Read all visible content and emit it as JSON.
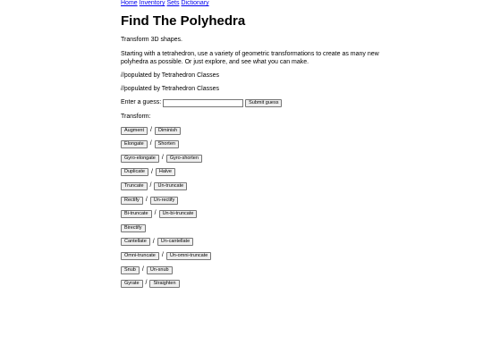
{
  "nav": {
    "links": [
      "Home",
      "Inventory",
      "Sets",
      "Dictionary"
    ]
  },
  "page_title": "Find The Polyhedra",
  "tagline": "Transform 3D shapes.",
  "description": "Starting with a tetrahedron, use a variety of geometric transformations to create as many new polyhedra as possible. Or just explore, and see what you can make.",
  "populated_1": "//populated by Tetrahedron Classes",
  "populated_2": "//populated by Tetrahedron Classes",
  "guess": {
    "label": "Enter a guess:",
    "value": "",
    "placeholder": "",
    "submit_label": "Submit guess"
  },
  "transform_label": "Transform:",
  "separator": "/",
  "transforms": [
    [
      "Augment",
      "Diminish"
    ],
    [
      "Elongate",
      "Shorten"
    ],
    [
      "Gyro-elongate",
      "Gyro-shorten"
    ],
    [
      "Duplicate",
      "Halve"
    ],
    [
      "Truncate",
      "Un-truncate"
    ],
    [
      "Rectify",
      "Un-rectify"
    ],
    [
      "Bi-truncate",
      "Un-bi-truncate"
    ],
    [
      "Birectify"
    ],
    [
      "Cantellate",
      "Un-cantellate"
    ],
    [
      "Omni-truncate",
      "Un-omni-truncate"
    ],
    [
      "Snub",
      "Un-snub"
    ],
    [
      "Gyrate",
      "Straighten"
    ]
  ]
}
